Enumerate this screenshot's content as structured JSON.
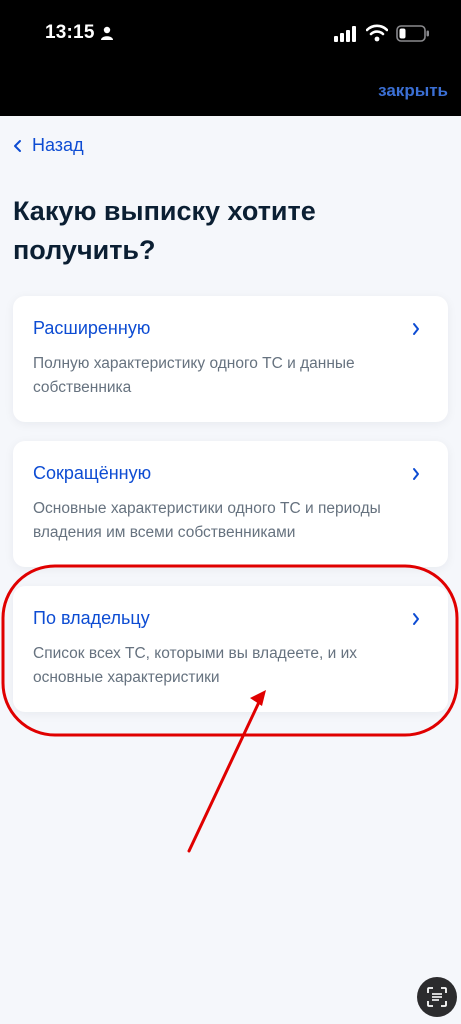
{
  "status_bar": {
    "time": "13:15"
  },
  "header": {
    "close_label": "закрыть"
  },
  "nav": {
    "back_label": "Назад"
  },
  "page": {
    "title": "Какую выписку хотите получить?"
  },
  "options": [
    {
      "title": "Расширенную",
      "description": "Полную характеристику одного ТС и данные собственника"
    },
    {
      "title": "Сокращённую",
      "description": "Основные характеристики одного ТС и периоды владения им всеми собственниками"
    },
    {
      "title": "По владельцу",
      "description": "Список всех ТС, которыми вы владеете, и их основные характеристики"
    }
  ],
  "colors": {
    "accent": "#0d4cd3",
    "annotation": "#e00000",
    "background": "#f5f7fb"
  }
}
